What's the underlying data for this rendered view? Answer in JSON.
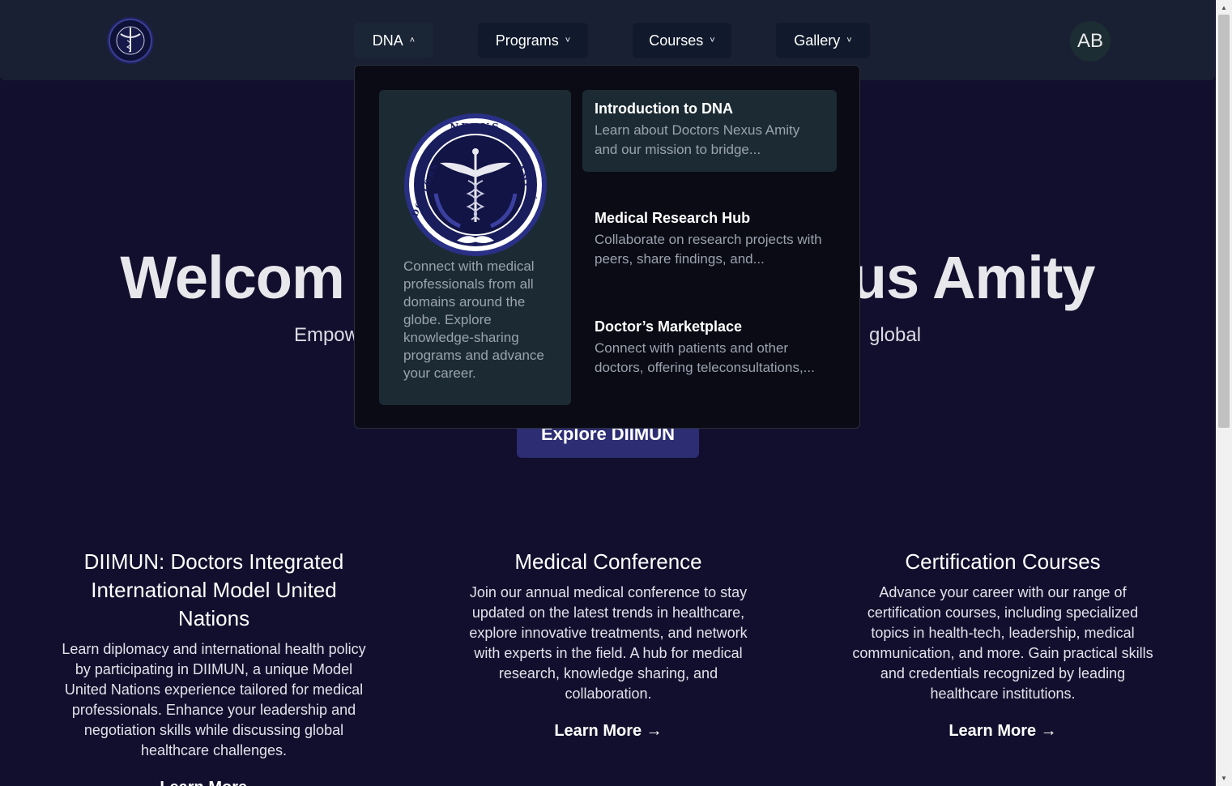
{
  "nav": {
    "items": [
      {
        "label": "DNA",
        "chevron": "˄"
      },
      {
        "label": "Programs",
        "chevron": "˅"
      },
      {
        "label": "Courses",
        "chevron": "˅"
      },
      {
        "label": "Gallery",
        "chevron": "˅"
      }
    ],
    "avatar": "AB"
  },
  "logo": {
    "text_top": "NEXUS",
    "text_left": "DOCTORS",
    "text_right": "AMITY"
  },
  "hero": {
    "title_left": "Welcom",
    "title_right": "us Amity",
    "subtitle_left": "Empow",
    "subtitle_right": "global",
    "cta": "Explore DIIMUN"
  },
  "dropdown": {
    "card_text": "Connect with medical professionals from all domains around the globe. Explore knowledge-sharing programs and advance your career.",
    "items": [
      {
        "title": "Introduction to DNA",
        "desc": "Learn about Doctors Nexus Amity and our mission to bridge..."
      },
      {
        "title": "Medical Research Hub",
        "desc": "Collaborate on research projects with peers, share findings, and..."
      },
      {
        "title": "Doctor’s Marketplace",
        "desc": "Connect with patients and other doctors, offering teleconsultations,..."
      }
    ]
  },
  "features": [
    {
      "title": "DIIMUN: Doctors Integrated International Model United Nations",
      "desc": "Learn diplomacy and international health policy by participating in DIIMUN, a unique Model United Nations experience tailored for medical professionals. Enhance your leadership and negotiation skills while discussing global healthcare challenges.",
      "link": "Learn More →"
    },
    {
      "title": "Medical Conference",
      "desc": "Join our annual medical conference to stay updated on the latest trends in healthcare, explore innovative treatments, and network with experts in the field. A hub for medical research, knowledge sharing, and collaboration.",
      "link": "Learn More →"
    },
    {
      "title": "Certification Courses",
      "desc": "Advance your career with our range of certification courses, including specialized topics in health-tech, leadership, medical communication, and more. Gain practical skills and credentials recognized by leading healthcare institutions.",
      "link": "Learn More →"
    }
  ],
  "colors": {
    "background": "#120f2e",
    "header": "#1a2033",
    "accent": "#2d2d73",
    "panel": "#1c2b33"
  }
}
